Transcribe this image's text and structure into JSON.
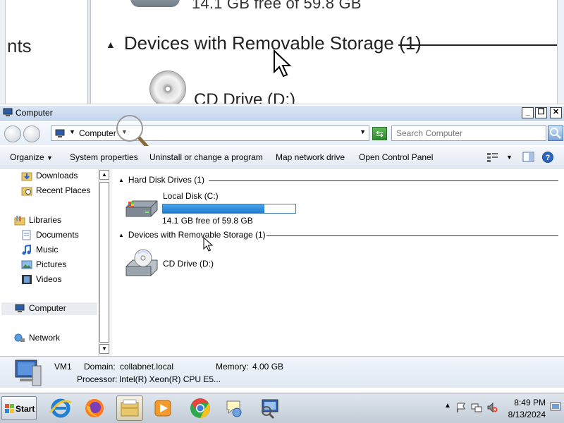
{
  "magnifier": {
    "top_text": "14.1 GB free of 59.8 GB",
    "side_text": "nts",
    "group_label": "Devices with Removable Storage (1)",
    "cd_label": "CD Drive (D:)"
  },
  "window": {
    "title": "Computer",
    "address": {
      "crumb": "Computer"
    },
    "search": {
      "placeholder": "Search Computer"
    },
    "toolbar": {
      "organize": "Organize",
      "system_properties": "System properties",
      "uninstall": "Uninstall or change a program",
      "map_drive": "Map network drive",
      "control_panel": "Open Control Panel"
    },
    "nav": {
      "downloads": "Downloads",
      "recent_places": "Recent Places",
      "libraries": "Libraries",
      "documents": "Documents",
      "music": "Music",
      "pictures": "Pictures",
      "videos": "Videos",
      "computer": "Computer",
      "network": "Network"
    },
    "content": {
      "hdd_group": "Hard Disk Drives (1)",
      "local_disk": "Local Disk (C:)",
      "local_disk_used_fraction": 0.764,
      "free_text": "14.1 GB free of 59.8 GB",
      "removable_group": "Devices with Removable Storage (1)",
      "cd_drive": "CD Drive (D:)"
    },
    "details": {
      "name": "VM1",
      "domain_label": "Domain:",
      "domain_value": "collabnet.local",
      "memory_label": "Memory:",
      "memory_value": "4.00 GB",
      "processor_label": "Processor:",
      "processor_value": "Intel(R) Xeon(R) CPU E5..."
    }
  },
  "taskbar": {
    "start": "Start",
    "time": "8:49 PM",
    "date": "8/13/2024",
    "apps": [
      "internet-explorer",
      "firefox",
      "file-explorer",
      "media-player",
      "chrome",
      "help-support",
      "network-tool"
    ]
  },
  "colors": {
    "capacity_fill": "#1c7bd0",
    "titlebar": "#c5d7ee"
  }
}
